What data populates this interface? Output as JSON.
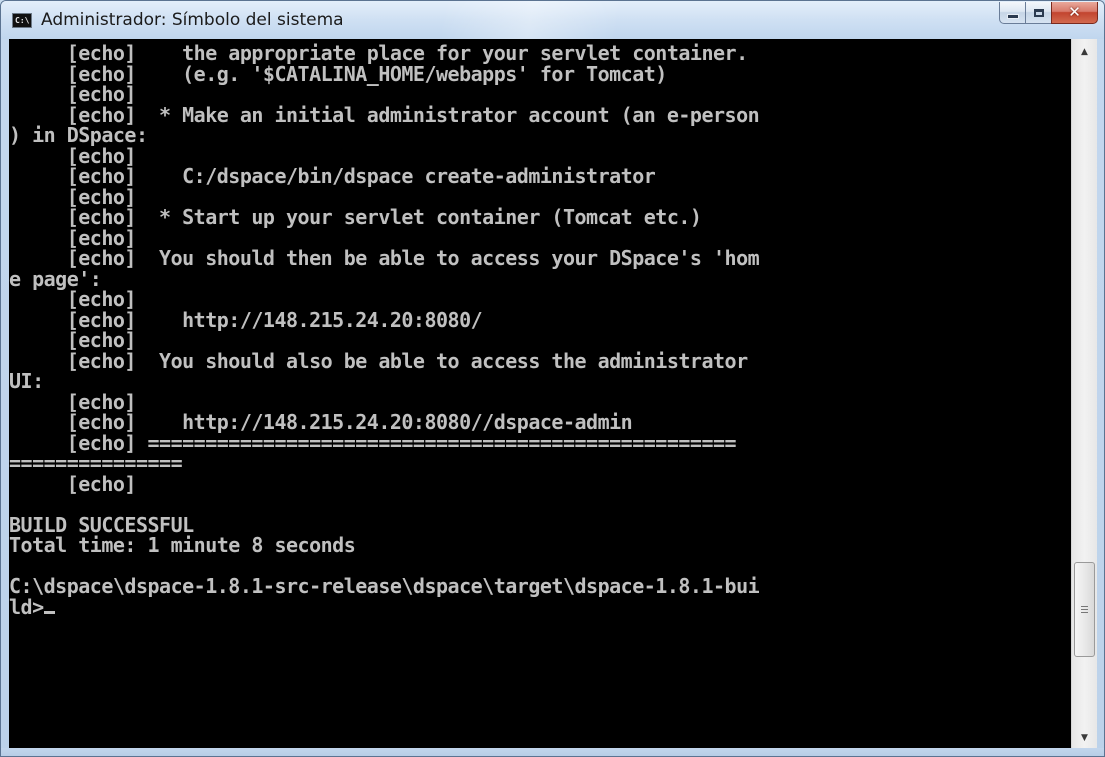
{
  "window": {
    "title": "Administrador: Símbolo del sistema",
    "icon_label": "C:\\",
    "buttons": {
      "minimize": "minimize-icon",
      "maximize": "maximize-icon",
      "close": "close-icon"
    }
  },
  "console": {
    "lines": [
      "     [echo]    the appropriate place for your servlet container.",
      "     [echo]    (e.g. '$CATALINA_HOME/webapps' for Tomcat)",
      "     [echo]",
      "     [echo]  * Make an initial administrator account (an e-person",
      ") in DSpace:",
      "     [echo]",
      "     [echo]    C:/dspace/bin/dspace create-administrator",
      "     [echo]",
      "     [echo]  * Start up your servlet container (Tomcat etc.)",
      "     [echo]",
      "     [echo]  You should then be able to access your DSpace's 'hom",
      "e page':",
      "     [echo]",
      "     [echo]    http://148.215.24.20:8080/",
      "     [echo]",
      "     [echo]  You should also be able to access the administrator",
      "UI:",
      "     [echo]",
      "     [echo]    http://148.215.24.20:8080//dspace-admin",
      "     [echo] ===================================================",
      "===============",
      "     [echo]",
      "",
      "BUILD SUCCESSFUL",
      "Total time: 1 minute 8 seconds",
      "",
      "C:\\dspace\\dspace-1.8.1-src-release\\dspace\\target\\dspace-1.8.1-bui",
      "ld>"
    ]
  },
  "scrollbar": {
    "up_icon": "scroll-up-arrow-icon",
    "down_icon": "scroll-down-arrow-icon",
    "position_fraction": 0.88
  },
  "colors": {
    "console_bg": "#000000",
    "console_fg": "#c0c0c0",
    "close_button": "#c2442f"
  }
}
